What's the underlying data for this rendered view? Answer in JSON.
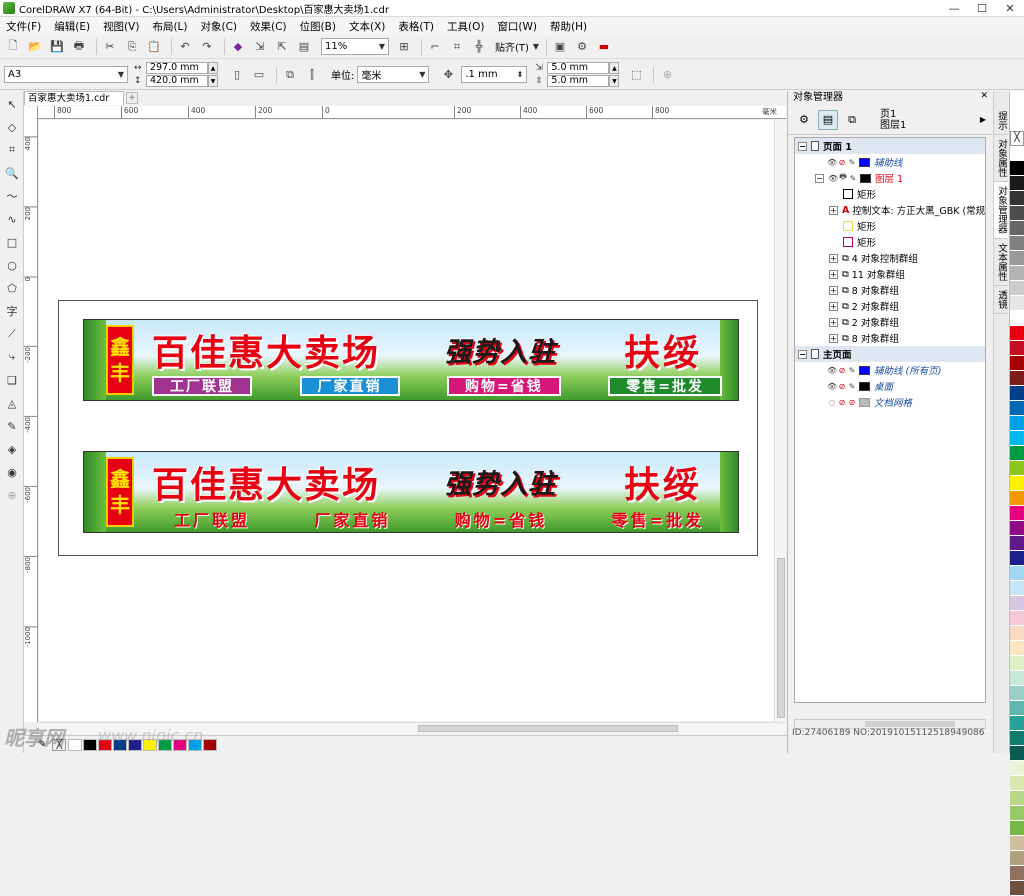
{
  "window": {
    "title": "CorelDRAW X7 (64-Bit) - C:\\Users\\Administrator\\Desktop\\百家惠大卖场1.cdr",
    "controls": [
      "—",
      "☐",
      "✕"
    ]
  },
  "menu": [
    "文件(F)",
    "编辑(E)",
    "视图(V)",
    "布局(L)",
    "对象(C)",
    "效果(C)",
    "位图(B)",
    "文本(X)",
    "表格(T)",
    "工具(O)",
    "窗口(W)",
    "帮助(H)"
  ],
  "toolbar": {
    "zoom": "11%",
    "snap_label": "贴齐(T)"
  },
  "propbar": {
    "page_size": "A3",
    "width": "297.0 mm",
    "height": "420.0 mm",
    "unit_label": "单位:",
    "unit": "毫米",
    "nudge": ".1 mm",
    "dup_x": "5.0 mm",
    "dup_y": "5.0 mm"
  },
  "document_tab": "百家惠大卖场1.cdr",
  "rulers": {
    "h": [
      "800",
      "600",
      "400",
      "200",
      "0",
      "200",
      "400",
      "600",
      "800",
      "毫米"
    ],
    "v": [
      "400",
      "200",
      "0",
      "-200",
      "-400",
      "-600",
      "-800",
      "-1000"
    ]
  },
  "banner1": {
    "badge": [
      "鑫",
      "丰"
    ],
    "headline": "百佳惠大卖场",
    "slogan": "强势入驻",
    "city": "扶绥",
    "tags": [
      {
        "text": "工厂联盟",
        "color": "#a0338f"
      },
      {
        "text": "厂家直销",
        "color": "#1b8fd6"
      },
      {
        "text": "购物=省钱",
        "color": "#d6177a"
      },
      {
        "text": "零售=批发",
        "color": "#1e8a2c"
      }
    ]
  },
  "banner2": {
    "badge": [
      "鑫",
      "丰"
    ],
    "headline": "百佳惠大卖场",
    "slogan": "强势入驻",
    "city": "扶绥",
    "tags": [
      "工厂联盟",
      "厂家直销",
      "购物=省钱",
      "零售=批发"
    ]
  },
  "object_manager": {
    "title": "对象管理器",
    "page_label": "页1",
    "layer_label": "图层1",
    "tree": {
      "page1": "页面 1",
      "guides": "辅助线",
      "layer1": "图层 1",
      "rect1": "矩形",
      "text_ctrl": "控制文本: 方正大黑_GBK (常规",
      "rect2": "矩形",
      "rect3": "矩形",
      "grp1": "4 对象控制群组",
      "grp2": "11 对象群组",
      "grp3": "8 对象群组",
      "grp4": "2 对象群组",
      "grp5": "2 对象群组",
      "grp6": "8 对象群组",
      "master": "主页面",
      "m_guides": "辅助线 (所有页)",
      "m_desktop": "桌面",
      "m_grid": "文档网格"
    }
  },
  "docker_tabs": [
    "提示",
    "对象属性",
    "对象管理器",
    "文本属性",
    "透镜"
  ],
  "palette": [
    "#ffffff",
    "#000000",
    "#1a1a1a",
    "#333333",
    "#4d4d4d",
    "#666666",
    "#808080",
    "#999999",
    "#b3b3b3",
    "#cccccc",
    "#e6e6e6",
    "#ffffff",
    "#e60012",
    "#c30d23",
    "#a40000",
    "#7d1a1a",
    "#003e8c",
    "#0068b7",
    "#00a0e9",
    "#00b7ee",
    "#009944",
    "#8fc31f",
    "#fff100",
    "#f39800",
    "#e4007f",
    "#920783",
    "#601986",
    "#1d2088",
    "#a3d6f0",
    "#c7e5f5",
    "#d7c7e0",
    "#f5c7d9",
    "#f7d9c4",
    "#fbe4c0",
    "#e0f0c8",
    "#c8e8d8",
    "#9bd0c8",
    "#62b6b1",
    "#2aa198",
    "#0f7c6e",
    "#0a5c50",
    "#e8f4d8",
    "#d8e8b0",
    "#b8d888",
    "#98c868",
    "#78b848",
    "#d0c0a0",
    "#b0a080",
    "#907060",
    "#705040"
  ],
  "status_colors": [
    "#ffffff",
    "#000000",
    "#e60012",
    "#003e8c",
    "#1d2088",
    "#fff100",
    "#009944",
    "#e4007f",
    "#00a0e9",
    "#a40000"
  ],
  "watermark": {
    "left": "昵享网",
    "url": "www.nipic.cn",
    "id": "ID:27406189 NO:20191015112518949086"
  }
}
